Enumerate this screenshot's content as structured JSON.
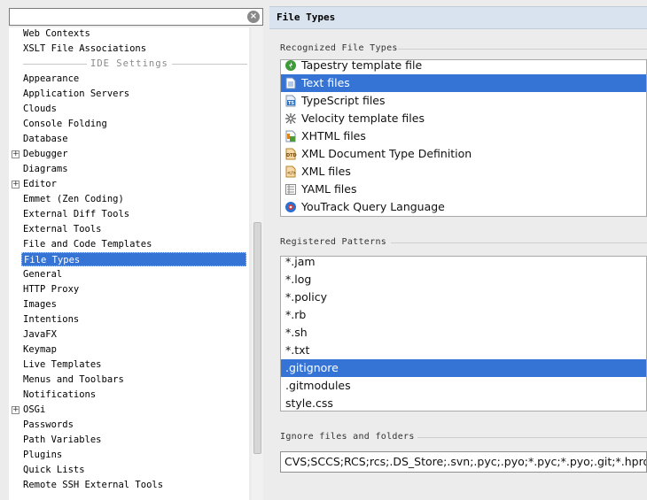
{
  "search": {
    "value": ""
  },
  "tree": [
    {
      "label": "Web Contexts",
      "sel": false,
      "expand": false
    },
    {
      "label": "XSLT File Associations",
      "sel": false,
      "expand": false
    },
    {
      "section": "IDE Settings"
    },
    {
      "label": "Appearance",
      "sel": false,
      "expand": false
    },
    {
      "label": "Application Servers",
      "sel": false,
      "expand": false
    },
    {
      "label": "Clouds",
      "sel": false,
      "expand": false
    },
    {
      "label": "Console Folding",
      "sel": false,
      "expand": false
    },
    {
      "label": "Database",
      "sel": false,
      "expand": false
    },
    {
      "label": "Debugger",
      "sel": false,
      "expand": true
    },
    {
      "label": "Diagrams",
      "sel": false,
      "expand": false
    },
    {
      "label": "Editor",
      "sel": false,
      "expand": true
    },
    {
      "label": "Emmet (Zen Coding)",
      "sel": false,
      "expand": false
    },
    {
      "label": "External Diff Tools",
      "sel": false,
      "expand": false
    },
    {
      "label": "External Tools",
      "sel": false,
      "expand": false
    },
    {
      "label": "File and Code Templates",
      "sel": false,
      "expand": false
    },
    {
      "label": "File Types",
      "sel": true,
      "expand": false
    },
    {
      "label": "General",
      "sel": false,
      "expand": false
    },
    {
      "label": "HTTP Proxy",
      "sel": false,
      "expand": false
    },
    {
      "label": "Images",
      "sel": false,
      "expand": false
    },
    {
      "label": "Intentions",
      "sel": false,
      "expand": false
    },
    {
      "label": "JavaFX",
      "sel": false,
      "expand": false
    },
    {
      "label": "Keymap",
      "sel": false,
      "expand": false
    },
    {
      "label": "Live Templates",
      "sel": false,
      "expand": false
    },
    {
      "label": "Menus and Toolbars",
      "sel": false,
      "expand": false
    },
    {
      "label": "Notifications",
      "sel": false,
      "expand": false
    },
    {
      "label": "OSGi",
      "sel": false,
      "expand": true
    },
    {
      "label": "Passwords",
      "sel": false,
      "expand": false
    },
    {
      "label": "Path Variables",
      "sel": false,
      "expand": false
    },
    {
      "label": "Plugins",
      "sel": false,
      "expand": false
    },
    {
      "label": "Quick Lists",
      "sel": false,
      "expand": false
    },
    {
      "label": "Remote SSH External Tools",
      "sel": false,
      "expand": false
    }
  ],
  "panel": {
    "title": "File Types",
    "recognized_label": "Recognized File Types",
    "patterns_label": "Registered Patterns",
    "ignore_label": "Ignore files and folders",
    "ignore_value": "CVS;SCCS;RCS;rcs;.DS_Store;.svn;.pyc;.pyo;*.pyc;*.pyo;.git;*.hprof;_svn;.hg;*.lib;*~;__pycache__;.bundle;*.rbc;"
  },
  "file_types": [
    {
      "label": "Tapestry template file",
      "icon": "tapestry-icon",
      "sel": false
    },
    {
      "label": "Text files",
      "icon": "text-file-icon",
      "sel": true
    },
    {
      "label": "TypeScript files",
      "icon": "typescript-icon",
      "sel": false
    },
    {
      "label": "Velocity template files",
      "icon": "velocity-icon",
      "sel": false
    },
    {
      "label": "XHTML files",
      "icon": "xhtml-icon",
      "sel": false
    },
    {
      "label": "XML Document Type Definition",
      "icon": "dtd-icon",
      "sel": false
    },
    {
      "label": "XML files",
      "icon": "xml-icon",
      "sel": false
    },
    {
      "label": "YAML files",
      "icon": "yaml-icon",
      "sel": false
    },
    {
      "label": "YouTrack Query Language",
      "icon": "youtrack-icon",
      "sel": false
    }
  ],
  "patterns": [
    {
      "label": "*.jam",
      "sel": false
    },
    {
      "label": "*.log",
      "sel": false
    },
    {
      "label": "*.policy",
      "sel": false
    },
    {
      "label": "*.rb",
      "sel": false
    },
    {
      "label": "*.sh",
      "sel": false
    },
    {
      "label": "*.txt",
      "sel": false
    },
    {
      "label": ".gitignore",
      "sel": true
    },
    {
      "label": ".gitmodules",
      "sel": false
    },
    {
      "label": "style.css",
      "sel": false
    }
  ]
}
